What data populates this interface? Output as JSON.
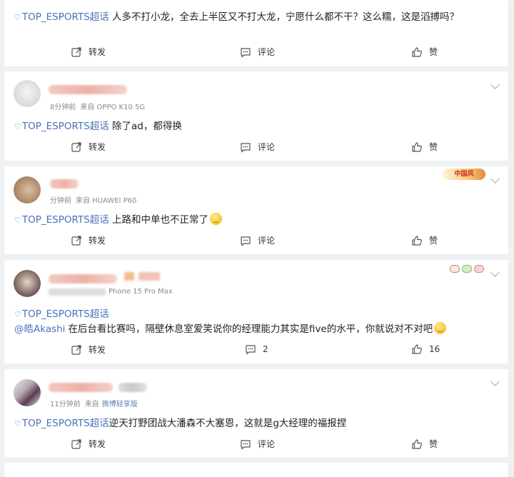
{
  "actions": {
    "repost": "转发",
    "comment": "评论",
    "like": "赞"
  },
  "topic_tag": "TOP_ESPORTS超话",
  "posts": [
    {
      "text": "人多不打小龙，全去上半区又不打大龙，宁愿什么都不干？这么糯，这是滔搏吗？"
    },
    {
      "time": "8分钟前",
      "source": "来自 OPPO K10 5G",
      "text": "除了ad，都得换"
    },
    {
      "time": "分钟前",
      "source": "来自 HUAWEI P60",
      "medal": "中国风",
      "text": "上路和中单也不正常了"
    },
    {
      "source": "Phone 15 Pro Max",
      "mention": "@皓Akashi",
      "text": "在后台看比赛吗，隔壁休息室爱笑说你的经理能力其实是five的水平，你就说对不对吧",
      "comment_count": "2",
      "like_count": "16"
    },
    {
      "time": "11分钟前",
      "source_prefix": "来自",
      "source": "微博轻享版",
      "text": "逆天打野团战大潘森不大塞恩，这就是g大经理的福报捏"
    }
  ],
  "icons": [
    "diamond-icon",
    "repost-icon",
    "comment-icon",
    "like-icon",
    "chevron-down-icon"
  ],
  "colors": {
    "link": "#4a72b8",
    "background": "#eef0f3",
    "card": "#ffffff",
    "meta": "#8a8a8a"
  }
}
